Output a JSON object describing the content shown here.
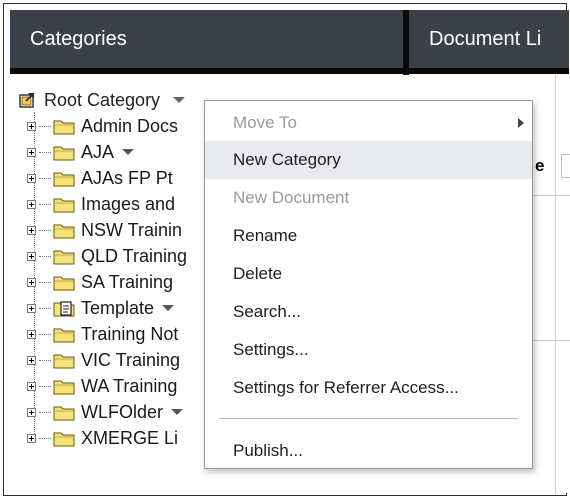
{
  "panels": {
    "categories_title": "Categories",
    "document_list_title": "Document Li"
  },
  "right_fragment": "e",
  "tree": {
    "root": {
      "label": "Root Category",
      "icon": "root-category-icon"
    },
    "items": [
      {
        "label": "Admin Docs",
        "icon": "folder-icon",
        "dropdown": false
      },
      {
        "label": "AJA",
        "icon": "folder-icon",
        "dropdown": true
      },
      {
        "label": "AJAs FP Pt",
        "icon": "folder-icon",
        "dropdown": false
      },
      {
        "label": "Images and",
        "icon": "folder-icon",
        "dropdown": false
      },
      {
        "label": "NSW Trainin",
        "icon": "folder-icon",
        "dropdown": false
      },
      {
        "label": "QLD Training",
        "icon": "folder-icon",
        "dropdown": false
      },
      {
        "label": "SA Training",
        "icon": "folder-icon",
        "dropdown": false
      },
      {
        "label": "Template",
        "icon": "template-folder-icon",
        "dropdown": true
      },
      {
        "label": "Training Not",
        "icon": "folder-icon",
        "dropdown": false
      },
      {
        "label": "VIC Training",
        "icon": "folder-icon",
        "dropdown": false
      },
      {
        "label": "WA Training",
        "icon": "folder-icon",
        "dropdown": false
      },
      {
        "label": "WLFOlder",
        "icon": "folder-icon",
        "dropdown": true
      },
      {
        "label": "XMERGE Li",
        "icon": "folder-icon",
        "dropdown": false
      }
    ]
  },
  "context_menu": {
    "items": [
      {
        "label": "Move To",
        "disabled": true,
        "submenu": true
      },
      {
        "label": "New Category",
        "disabled": false,
        "highlighted": true
      },
      {
        "label": "New Document",
        "disabled": true
      },
      {
        "label": "Rename",
        "disabled": false
      },
      {
        "label": "Delete",
        "disabled": false
      },
      {
        "label": "Search...",
        "disabled": false
      },
      {
        "label": "Settings...",
        "disabled": false
      },
      {
        "label": "Settings for Referrer Access...",
        "disabled": false
      },
      {
        "label": "Publish...",
        "disabled": false
      }
    ]
  },
  "colors": {
    "header_bg": "#3c4147",
    "folder_yellow": "#f4e27a",
    "menu_highlight": "#e8eaed",
    "disabled_text": "#9b9b9b"
  }
}
